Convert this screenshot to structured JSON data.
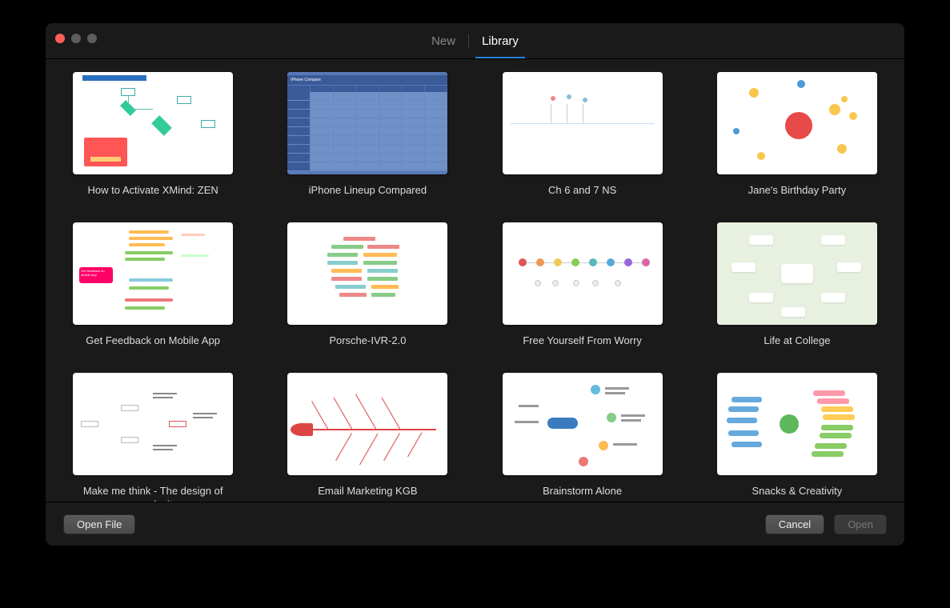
{
  "tabs": [
    {
      "label": "New",
      "active": false
    },
    {
      "label": "Library",
      "active": true
    }
  ],
  "templates": [
    {
      "label": "How to Activate XMind: ZEN",
      "thumb": "flow"
    },
    {
      "label": "iPhone Lineup Compared",
      "thumb": "table",
      "tableHead": "iPhone Compare"
    },
    {
      "label": "Ch 6 and 7 NS",
      "thumb": "blank"
    },
    {
      "label": "Jane's Birthday Party",
      "thumb": "jane"
    },
    {
      "label": "Get Feedback on Mobile App",
      "thumb": "pink",
      "pillText": "Get feedback on Mobile App"
    },
    {
      "label": "Porsche-IVR-2.0",
      "thumb": "org"
    },
    {
      "label": "Free Yourself From Worry",
      "thumb": "icons"
    },
    {
      "label": "Life at College",
      "thumb": "college"
    },
    {
      "label": "Make me think - The design of complexity",
      "thumb": "sparse"
    },
    {
      "label": "Email Marketing KGB",
      "thumb": "fish"
    },
    {
      "label": "Brainstorm Alone",
      "thumb": "brain"
    },
    {
      "label": "Snacks & Creativity",
      "thumb": "snack"
    }
  ],
  "footer": {
    "openFile": "Open File",
    "cancel": "Cancel",
    "open": "Open"
  }
}
